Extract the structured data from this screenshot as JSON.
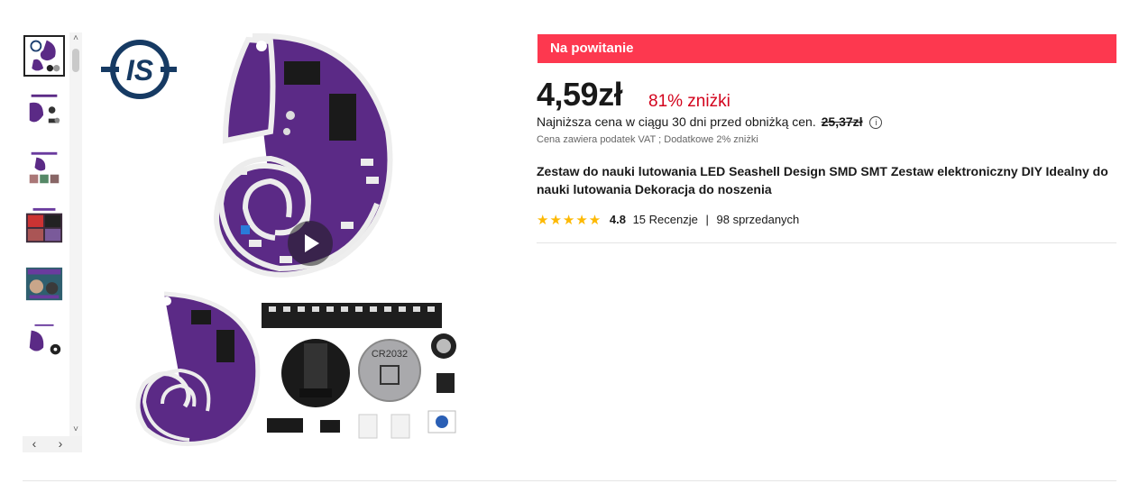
{
  "gallery": {
    "thumbnails": [
      {
        "name": "thumb-1-overview",
        "active": true
      },
      {
        "name": "thumb-2-components",
        "active": false,
        "caption": "Components in Package"
      },
      {
        "name": "thumb-3-tips",
        "active": false,
        "caption": "Top Gifts for Education & Learning"
      },
      {
        "name": "thumb-4-family",
        "active": false,
        "caption": "Family Soldering"
      },
      {
        "name": "thumb-5-workshop",
        "active": false
      },
      {
        "name": "thumb-6-details",
        "active": false,
        "caption": "Product Details"
      }
    ],
    "nav_prev": "‹",
    "nav_next": "›",
    "scroll_up": "˄",
    "scroll_down": "˅"
  },
  "main_image": {
    "logo_text": "IS",
    "battery_label": "CR2032"
  },
  "promo_banner": "Na powitanie",
  "price": {
    "current": "4,59zł",
    "discount": "81% zniżki",
    "lowest_label": "Najniższa cena w ciągu 30 dni przed obniżką cen.",
    "lowest_value": "25,37zł",
    "tax_note": "Cena zawiera podatek VAT ; Dodatkowe 2% zniżki"
  },
  "product": {
    "title": "Zestaw do nauki lutowania LED Seashell Design SMD SMT Zestaw elektroniczny DIY Idealny do nauki lutowania Dekoracja do noszenia"
  },
  "rating": {
    "stars": "★★★★★",
    "score": "4.8",
    "reviews": "15 Recenzje",
    "separator": "|",
    "sold": "98 sprzedanych"
  },
  "colors": {
    "promo_bg": "#fd384f",
    "discount": "#d3031c",
    "stars": "#fdb903",
    "pcb_purple": "#5b2a86"
  }
}
